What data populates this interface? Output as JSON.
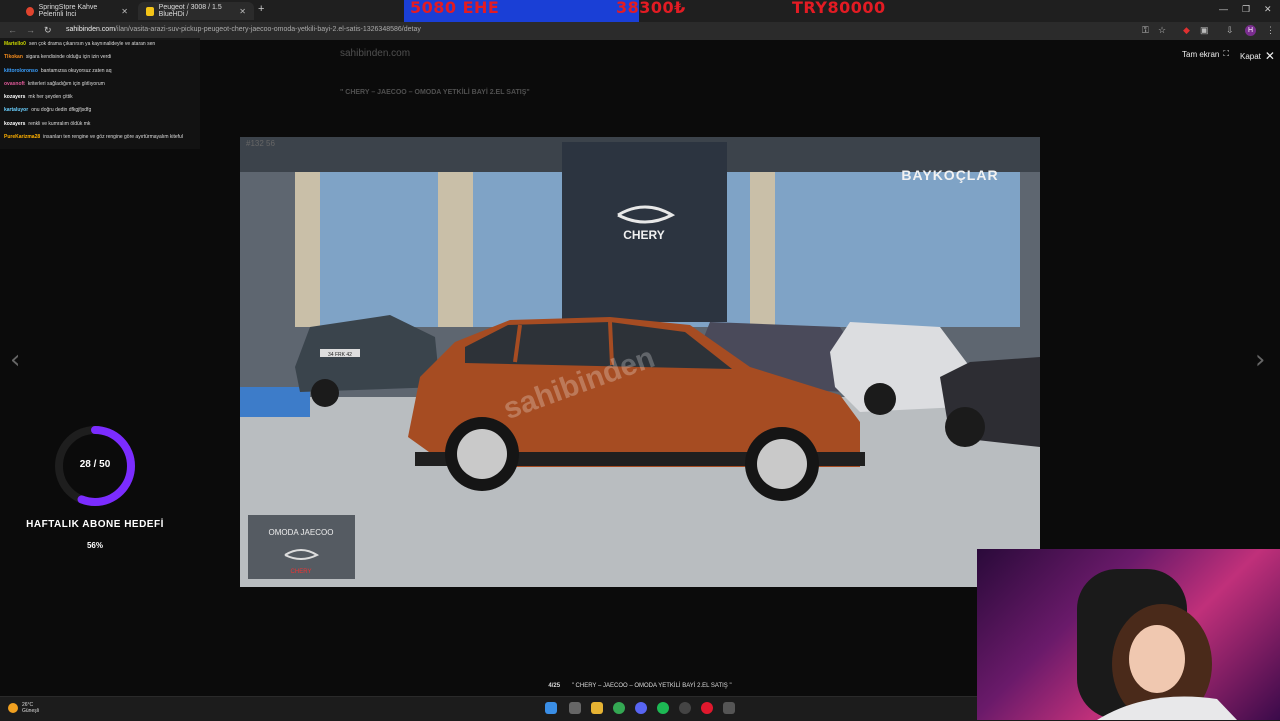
{
  "browser": {
    "tabs": [
      {
        "title": "SpringStore Kahve Pelerinli İnci",
        "favicon_color": "#e0442e"
      },
      {
        "title": "Peugeot / 3008 / 1.5 BlueHDi /",
        "favicon_color": "#f5c518"
      }
    ],
    "new_tab_icon": "plus-icon",
    "url_host": "sahibinden.com",
    "url_path": "/ilan/vasita-arazi-suv-pickup-peugeot-chery-jaecoo-omoda-yetkili-bayi-2.el-satis-1326348586/detay",
    "window_controls": [
      "minimize-icon",
      "restore-icon",
      "close-icon"
    ]
  },
  "stream_overlay": {
    "left_text": "5080 EHE",
    "mid_text": "38300₺",
    "right_text": "TRY80000",
    "text_color": "#e31b23",
    "bar_color": "#1a3fd6"
  },
  "chat": [
    {
      "user": "Martello0",
      "user_color": "#c8d400",
      "text": "sen çok drama çıkarırsın ya kaynınalideyle ve ataran sen"
    },
    {
      "user": "Tlkokan",
      "user_color": "#f28a1c",
      "text": "sigara kendisinde olduğu için izin verdi"
    },
    {
      "user": "kittoroloronso",
      "user_color": "#3aa0ff",
      "text": "bantamızsa okuyorsuz zaten aq"
    },
    {
      "user": "ovasnoft",
      "user_color": "#e05a9a",
      "text": "kriterleri sağladığım için glıtlıyorum"
    },
    {
      "user": "kozayers",
      "user_color": "#ffffff",
      "text": "mk her şeyden çittik"
    },
    {
      "user": "kartaluyor",
      "user_color": "#6ad0ff",
      "text": "onu doğru dedin dfkgjfjsdfg"
    },
    {
      "user": "kozayers",
      "user_color": "#ffffff",
      "text": "renkli ve kumralım öldük mk"
    },
    {
      "user": "PureKarizma28",
      "user_color": "#ffb000",
      "text": "insanları ten rengine ve göz rengine göre ayırtürmayalım kiteful"
    }
  ],
  "viewer": {
    "fullscreen_label": "Tam ekran",
    "close_label": "Kapat",
    "prev_icon": "chevron-left-icon",
    "next_icon": "chevron-right-icon",
    "photo_id": "#132   56",
    "storefront_sign": "BAYKOÇLAR",
    "brand_logo_text": "CHERY",
    "plate_text": "34 FRK 42",
    "caption_counter": "4/25",
    "caption_title": "\" CHERY – JAECOO – OMODA YETKİLİ BAYİ 2.EL SATIŞ \"",
    "watermark": "sahibinden"
  },
  "background_page": {
    "site": "sahibinden.com",
    "title": "\" CHERY – JAECOO – OMODA YETKİLİ BAYİ 2.EL SATIŞ\""
  },
  "sub_goal": {
    "current": 28,
    "target": 50,
    "progress_text": "28 / 50",
    "label": "HAFTALIK ABONE HEDEFİ",
    "percent_text": "56%",
    "ring_color": "#7b2cff"
  },
  "taskbar": {
    "weather_temp": "26°C",
    "weather_desc": "Güneşli",
    "apps": [
      "windows-icon",
      "search-icon",
      "file-explorer-icon",
      "chrome-icon",
      "discord-icon",
      "spotify-icon",
      "obs-icon",
      "opera-icon",
      "task-manager-icon"
    ]
  }
}
